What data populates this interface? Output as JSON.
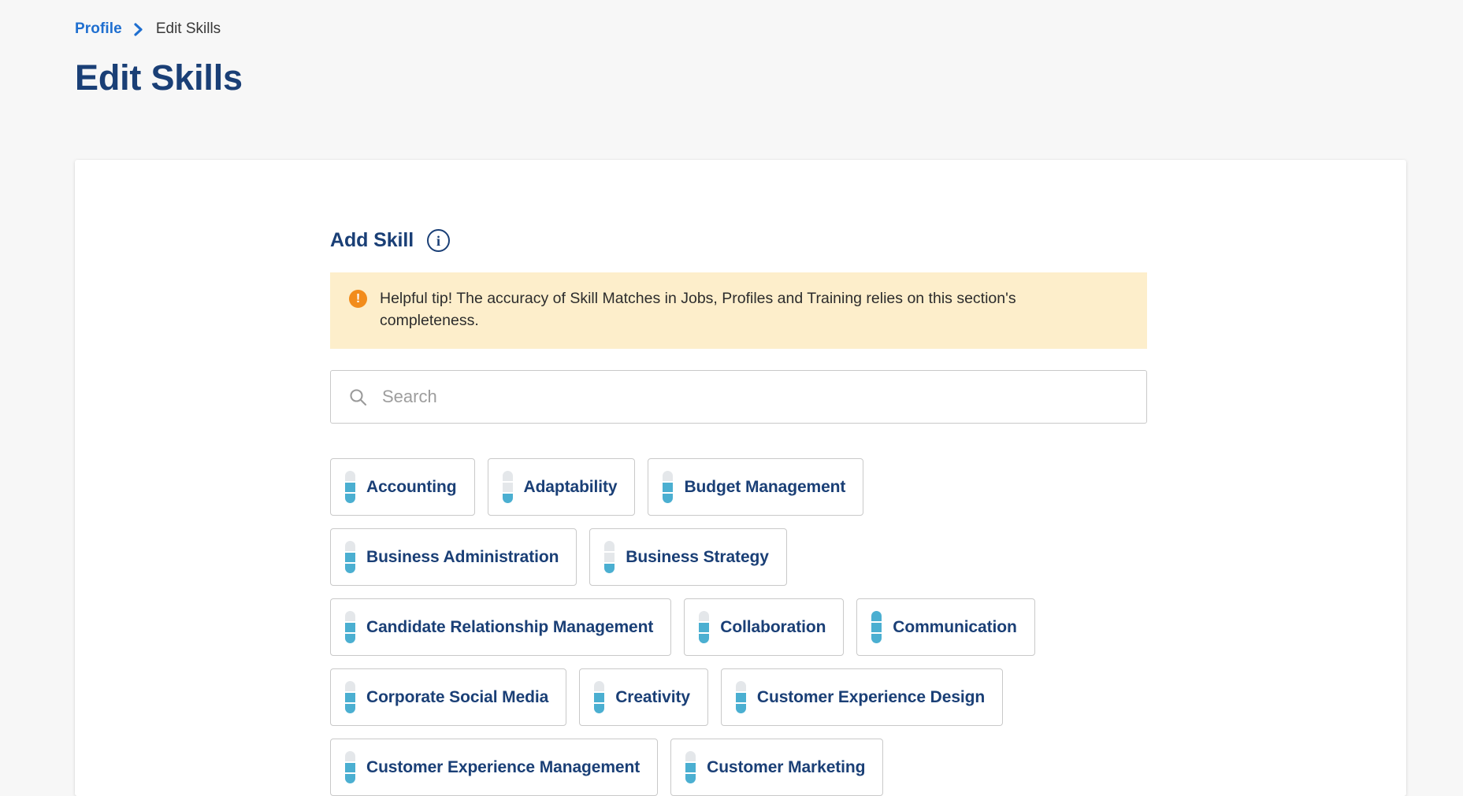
{
  "breadcrumb": {
    "parent": "Profile",
    "separator_icon": "chevron-right-icon",
    "current": "Edit Skills"
  },
  "page": {
    "title": "Edit Skills"
  },
  "section": {
    "title": "Add Skill",
    "info_icon": "info-circle-icon"
  },
  "tip": {
    "icon": "exclamation-circle-icon",
    "text": "Helpful tip! The accuracy of Skill Matches in Jobs, Profiles and Training relies on this section's completeness."
  },
  "search": {
    "icon": "search-icon",
    "value": "",
    "placeholder": "Search"
  },
  "colors": {
    "page_background": "#f7f7f7",
    "card_background": "#ffffff",
    "title_navy": "#1a3f76",
    "link_blue": "#1f6fd0",
    "tip_background": "#fdeecb",
    "tip_icon_orange": "#f28c1c",
    "meter_filled": "#4bafd1",
    "meter_empty": "#e4e7ea",
    "chip_border": "#c9c9c9"
  },
  "skill_meter": {
    "total_segments": 3
  },
  "skill_rows": [
    [
      {
        "label": "Accounting",
        "level": 2
      },
      {
        "label": "Adaptability",
        "level": 1
      },
      {
        "label": "Budget Management",
        "level": 2
      }
    ],
    [
      {
        "label": "Business Administration",
        "level": 2
      },
      {
        "label": "Business Strategy",
        "level": 1
      }
    ],
    [
      {
        "label": "Candidate Relationship Management",
        "level": 2
      },
      {
        "label": "Collaboration",
        "level": 2
      },
      {
        "label": "Communication",
        "level": 3
      }
    ],
    [
      {
        "label": "Corporate Social Media",
        "level": 2
      },
      {
        "label": "Creativity",
        "level": 2
      },
      {
        "label": "Customer Experience Design",
        "level": 2
      }
    ],
    [
      {
        "label": "Customer Experience Management",
        "level": 2
      },
      {
        "label": "Customer Marketing",
        "level": 2
      }
    ]
  ]
}
